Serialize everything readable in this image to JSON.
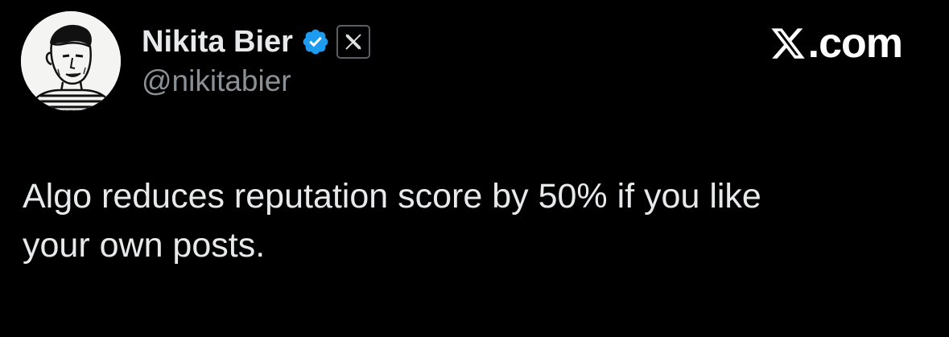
{
  "tweet": {
    "author": {
      "display_name": "Nikita Bier",
      "handle": "@nikitabier",
      "avatar": "sketch-portrait-avatar",
      "verified_icon": "verified-check-icon",
      "affiliate_icon": "x-logo-icon"
    },
    "brand": {
      "logo_icon": "x-logo-icon",
      "suffix": ".com"
    },
    "text_line1": "Algo reduces reputation score by 50% if you like",
    "text_line2": "your own posts."
  },
  "colors": {
    "background": "#000000",
    "name": "#e7e9ea",
    "handle": "#8b9096",
    "verified": "#1d9bf0",
    "brand": "#ffffff"
  }
}
